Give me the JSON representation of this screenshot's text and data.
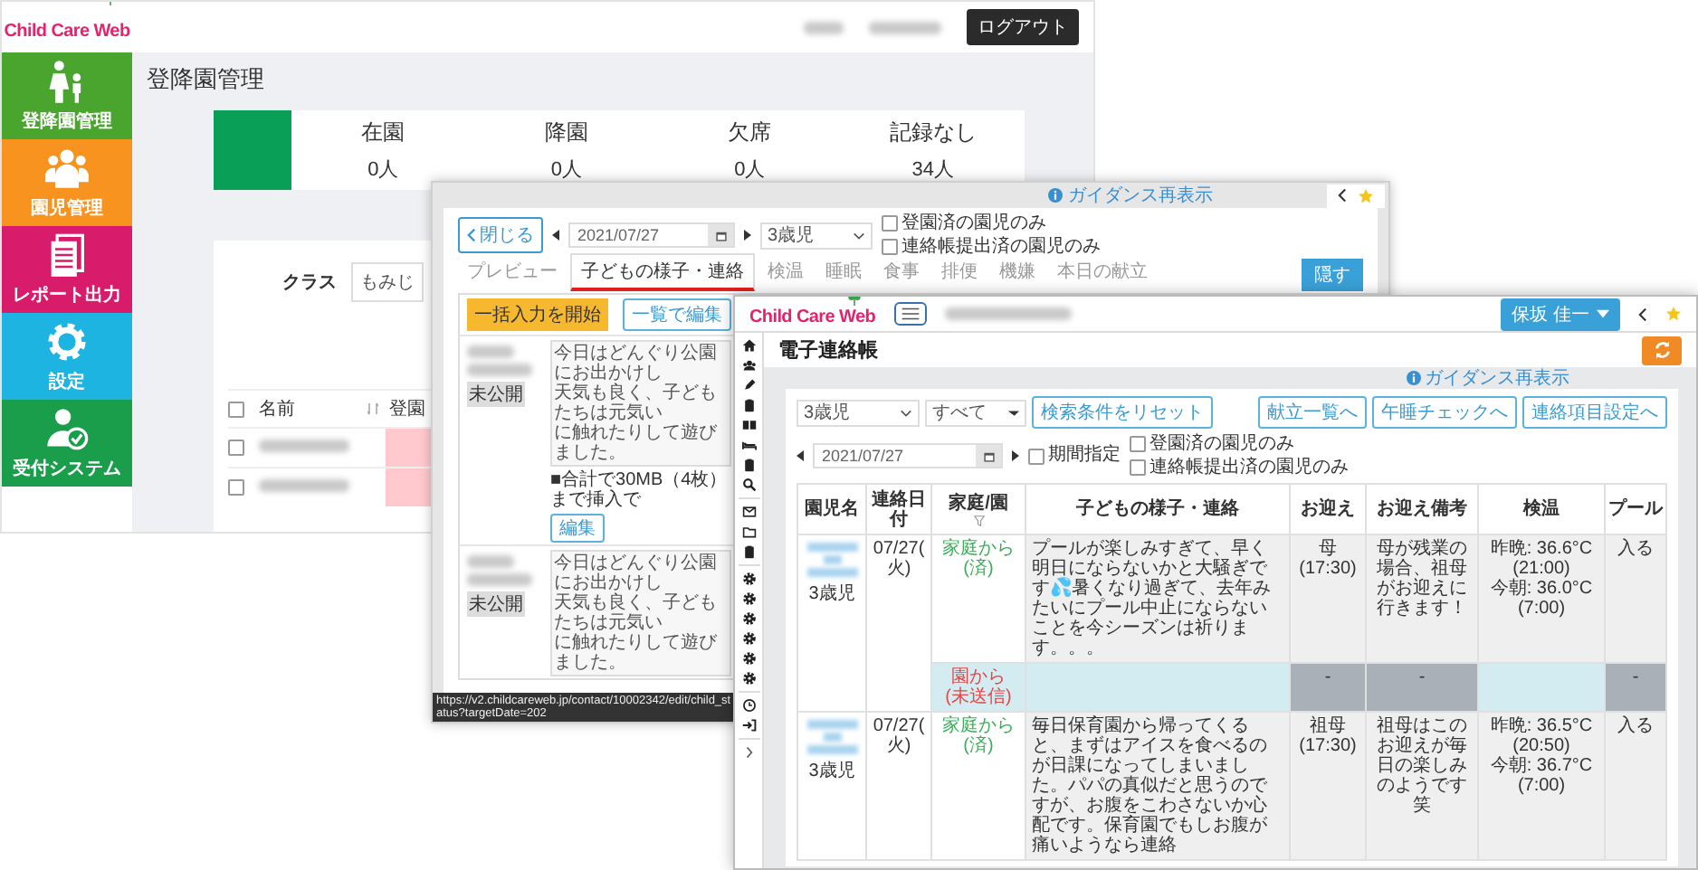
{
  "attendance_window": {
    "logo": "Child Care Web",
    "sidebar": [
      {
        "label": "登降園管理",
        "color": "#4aa52e"
      },
      {
        "label": "園児管理",
        "color": "#f7931e"
      },
      {
        "label": "レポート出力",
        "color": "#d81b6a"
      },
      {
        "label": "設定",
        "color": "#1db4e2"
      },
      {
        "label": "受付システム",
        "color": "#1a9e4b"
      }
    ],
    "logout_button": "ログアウト",
    "title": "登降園管理",
    "stats": [
      {
        "label": "在園",
        "value": "0人"
      },
      {
        "label": "降園",
        "value": "0人"
      },
      {
        "label": "欠席",
        "value": "0人"
      },
      {
        "label": "記録なし",
        "value": "34人"
      }
    ],
    "class_filter": {
      "label": "クラス",
      "value": "もみじ"
    },
    "table": {
      "select_all_checked": false,
      "columns": [
        "名前",
        "登園"
      ],
      "rows": [
        {
          "checked": false
        },
        {
          "checked": false
        }
      ]
    }
  },
  "contact_editor_window": {
    "guidance_link": "ガイダンス再表示",
    "close_button": "閉じる",
    "date": "2021/07/27",
    "class_select": "3歳児",
    "filters": [
      {
        "label": "登園済の園児のみ",
        "checked": false
      },
      {
        "label": "連絡帳提出済の園児のみ",
        "checked": false
      }
    ],
    "tabs": [
      {
        "label": "プレビュー",
        "selected": false
      },
      {
        "label": "子どもの様子・連絡",
        "selected": true
      },
      {
        "label": "検温",
        "selected": false
      },
      {
        "label": "睡眠",
        "selected": false
      },
      {
        "label": "食事",
        "selected": false
      },
      {
        "label": "排便",
        "selected": false
      },
      {
        "label": "機嫌",
        "selected": false
      },
      {
        "label": "本日の献立",
        "selected": false
      }
    ],
    "hide_button": "隠す",
    "bulk_input_button": "一括入力を開始",
    "list_edit_button": "一覧で編集",
    "entries": [
      {
        "badge": "未公開",
        "note_lines": [
          "今日はどんぐり公園にお出かけし",
          "天気も良く、子どもたちは元気い",
          "に触れたりして遊びました。"
        ],
        "size_hint": "■合計で30MB（4枚）まで挿入で",
        "edit_button": "編集"
      },
      {
        "badge": "未公開",
        "note_lines": [
          "今日はどんぐり公園にお出かけし",
          "天気も良く、子どもたちは元気い",
          "に触れたりして遊びました。"
        ]
      }
    ],
    "status_url": "https://v2.childcareweb.jp/contact/10002342/edit/child_status?targetDate=202"
  },
  "contact_book_window": {
    "logo": "Child Care Web",
    "user_button": "保坂 佳一",
    "title": "電子連絡帳",
    "guidance_link": "ガイダンス再表示",
    "class_select": "3歳児",
    "type_select": "すべて",
    "reset_button": "検索条件をリセット",
    "link_buttons": [
      "献立一覧へ",
      "午睡チェックへ",
      "連絡項目設定へ"
    ],
    "date": "2021/07/27",
    "period_filter": {
      "label": "期間指定",
      "checked": false
    },
    "filters": [
      {
        "label": "登園済の園児のみ",
        "checked": false
      },
      {
        "label": "連絡帳提出済の園児のみ",
        "checked": false
      }
    ],
    "table": {
      "columns": [
        "園児名",
        "連絡日付",
        "家庭/園",
        "子どもの様子・連絡",
        "お迎え",
        "お迎え備考",
        "検温",
        "プール"
      ],
      "rows": [
        {
          "class": "3歳児",
          "date": "07/27(火)",
          "home": {
            "label": "家庭から",
            "status": "(済)",
            "sent": true
          },
          "message": "プールが楽しみすぎて、早く明日にならないかと大騒ぎです💦暑くなり過ぎて、去年みたいにプール中止にならないことを今シーズンは祈ります。。。",
          "pickup_person": "母",
          "pickup_time": "(17:30)",
          "pickup_note": "母が残業の場合、祖母がお迎えに行きます！",
          "temperature": [
            "昨晩: 36.6°C (21:00)",
            "今朝: 36.0°C (7:00)"
          ],
          "pool": "入る",
          "school": {
            "label": "園から",
            "status": "(未送信)",
            "sent": false,
            "pickup": "-",
            "pickup_note": "-",
            "pool": "-"
          }
        },
        {
          "class": "3歳児",
          "date": "07/27(火)",
          "home": {
            "label": "家庭から",
            "status": "(済)",
            "sent": true
          },
          "message": "毎日保育園から帰ってくると、まずはアイスを食べるのが日課になってしまいました。パパの真似だと思うのですが、お腹をこわさないか心配です。保育園でもしお腹が痛いようなら連絡",
          "pickup_person": "祖母",
          "pickup_time": "(17:30)",
          "pickup_note": "祖母はこのお迎えが毎日の楽しみのようです笑",
          "temperature": [
            "昨晩: 36.5°C (20:50)",
            "今朝: 36.7°C (7:00)"
          ],
          "pool": "入る"
        }
      ]
    }
  }
}
